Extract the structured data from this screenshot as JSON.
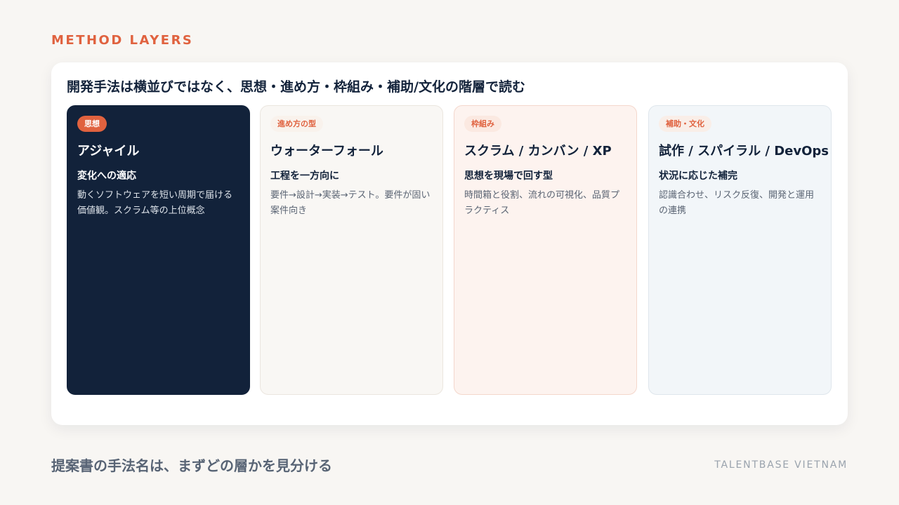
{
  "eyebrow": "METHOD LAYERS",
  "headline": "開発手法は横並びではなく、思想・進め方・枠組み・補助/文化の階層で読む",
  "cards": [
    {
      "badge": "思想",
      "title": "アジャイル",
      "subtitle": "変化への適応",
      "description": "動くソフトウェアを短い周期で届ける価値観。スクラム等の上位概念"
    },
    {
      "badge": "進め方の型",
      "title": "ウォーターフォール",
      "subtitle": "工程を一方向に",
      "description": "要件→設計→実装→テスト。要件が固い案件向き"
    },
    {
      "badge": "枠組み",
      "title": "スクラム / カンバン / XP",
      "subtitle": "思想を現場で回す型",
      "description": "時間箱と役割、流れの可視化、品質プラクティス"
    },
    {
      "badge": "補助・文化",
      "title": "試作 / スパイラル / DevOps",
      "subtitle": "状況に応じた補完",
      "description": "認識合わせ、リスク反復、開発と運用の連携"
    }
  ],
  "footer": {
    "title": "提案書の手法名は、まずどの層かを見分ける",
    "brand": "TALENTBASE VIETNAM"
  },
  "colors": {
    "accent": "#e0623f",
    "navy": "#12223a",
    "background": "#f8f6f3"
  }
}
